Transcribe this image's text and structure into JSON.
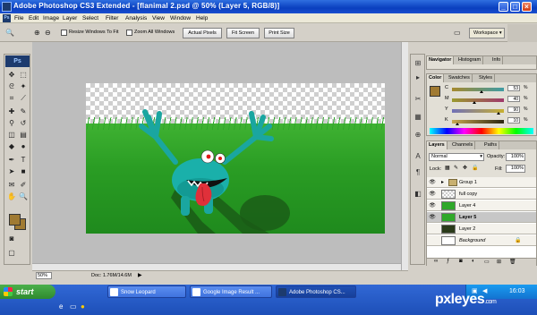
{
  "window": {
    "title": "Adobe Photoshop CS3 Extended - [flanimal 2.psd @ 50% (Layer 5, RGB/8)]",
    "min": "_",
    "max": "□",
    "close": "×"
  },
  "menu": [
    "File",
    "Edit",
    "Image",
    "Layer",
    "Select",
    "Filter",
    "Analysis",
    "View",
    "Window",
    "Help"
  ],
  "options": {
    "resize_windows": "Resize Windows To Fit",
    "zoom_all": "Zoom All Windows",
    "actual_pixels": "Actual Pixels",
    "fit_screen": "Fit Screen",
    "print_size": "Print Size",
    "workspace": "Workspace ▾"
  },
  "toolbox": {
    "logo": "Ps"
  },
  "colors": {
    "foreground": "#a07a32",
    "background": "#a07a32",
    "accent": "#1d3b6e"
  },
  "status": {
    "zoom": "50%",
    "doc": "Doc: 1.76M/14.6M"
  },
  "navigator": {
    "tabs": [
      "Navigator",
      "Histogram",
      "Info"
    ]
  },
  "color_panel": {
    "tabs": [
      "Color",
      "Swatches",
      "Styles"
    ],
    "channels": [
      {
        "label": "C",
        "value": "53",
        "pos": 0.53
      },
      {
        "label": "M",
        "value": "40",
        "pos": 0.4
      },
      {
        "label": "Y",
        "value": "90",
        "pos": 0.9
      },
      {
        "label": "K",
        "value": "10",
        "pos": 0.1
      }
    ],
    "pct": "%"
  },
  "layers_panel": {
    "tabs": [
      "Layers",
      "Channels",
      "Paths"
    ],
    "blend_mode": "Normal",
    "opacity_label": "Opacity:",
    "opacity": "100%",
    "lock_label": "Lock:",
    "fill_label": "Fill:",
    "fill": "100%",
    "layers": [
      {
        "name": "Group 1",
        "visible": true,
        "selected": false,
        "kind": "group"
      },
      {
        "name": "full copy",
        "visible": true,
        "selected": false,
        "kind": "checker"
      },
      {
        "name": "Layer 4",
        "visible": true,
        "selected": false,
        "kind": "grass"
      },
      {
        "name": "Layer 5",
        "visible": true,
        "selected": true,
        "kind": "grass"
      },
      {
        "name": "Layer 2",
        "visible": false,
        "selected": false,
        "kind": "dark"
      },
      {
        "name": "Background",
        "visible": false,
        "selected": false,
        "kind": "white"
      }
    ]
  },
  "taskbar": {
    "start": "start",
    "tasks": [
      {
        "label": "Snow Leopard",
        "active": false
      },
      {
        "label": "Google Image Result ...",
        "active": false
      },
      {
        "label": "Adobe Photoshop CS...",
        "active": true
      }
    ],
    "clock": "16:03"
  },
  "watermark": {
    "brand": "pxleyes",
    "suffix": ".com"
  }
}
